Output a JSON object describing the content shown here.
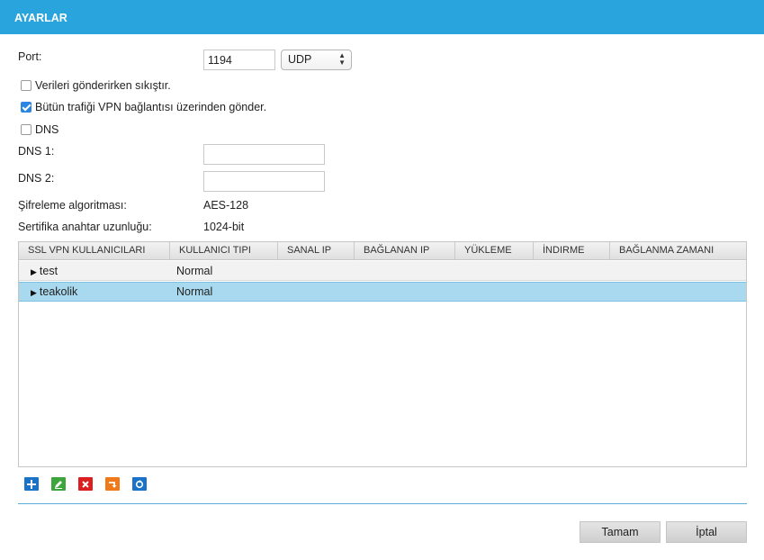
{
  "window": {
    "title": "AYARLAR"
  },
  "form": {
    "port_label": "Port:",
    "port_value": "1194",
    "protocol_value": "UDP",
    "compress_label": "Verileri gönderirken sıkıştır.",
    "compress_checked": false,
    "all_traffic_label": "Bütün trafiği VPN bağlantısı üzerinden gönder.",
    "all_traffic_checked": true,
    "dns_label": "DNS",
    "dns_checked": false,
    "dns1_label": "DNS 1:",
    "dns1_value": "",
    "dns2_label": "DNS 2:",
    "dns2_value": "",
    "encryption_label": "Şifreleme algoritması:",
    "encryption_value": "AES-128",
    "cert_label": "Sertifika anahtar uzunluğu:",
    "cert_value": "1024-bit"
  },
  "table": {
    "columns": [
      "SSL VPN KULLANICILARI",
      "KULLANICI TIPI",
      "SANAL IP",
      "BAĞLANAN IP",
      "YÜKLEME",
      "İNDIRME",
      "BAĞLANMA ZAMANI"
    ],
    "rows": [
      {
        "user": "test",
        "type": "Normal",
        "virtual_ip": "",
        "connected_ip": "",
        "upload": "",
        "download": "",
        "connect_time": "",
        "selected": false
      },
      {
        "user": "teakolik",
        "type": "Normal",
        "virtual_ip": "",
        "connected_ip": "",
        "upload": "",
        "download": "",
        "connect_time": "",
        "selected": true
      }
    ]
  },
  "toolbar": {
    "icons": [
      {
        "name": "add-icon",
        "color": "#1a73c9"
      },
      {
        "name": "edit-icon",
        "color": "#3ca63c"
      },
      {
        "name": "delete-icon",
        "color": "#d91f1f"
      },
      {
        "name": "export-icon",
        "color": "#f07a1a"
      },
      {
        "name": "refresh-icon",
        "color": "#1a73c9"
      }
    ]
  },
  "buttons": {
    "ok_label": "Tamam",
    "cancel_label": "İptal"
  },
  "colors": {
    "accent": "#2aa4dd",
    "selected_row": "#a9d9ee"
  }
}
